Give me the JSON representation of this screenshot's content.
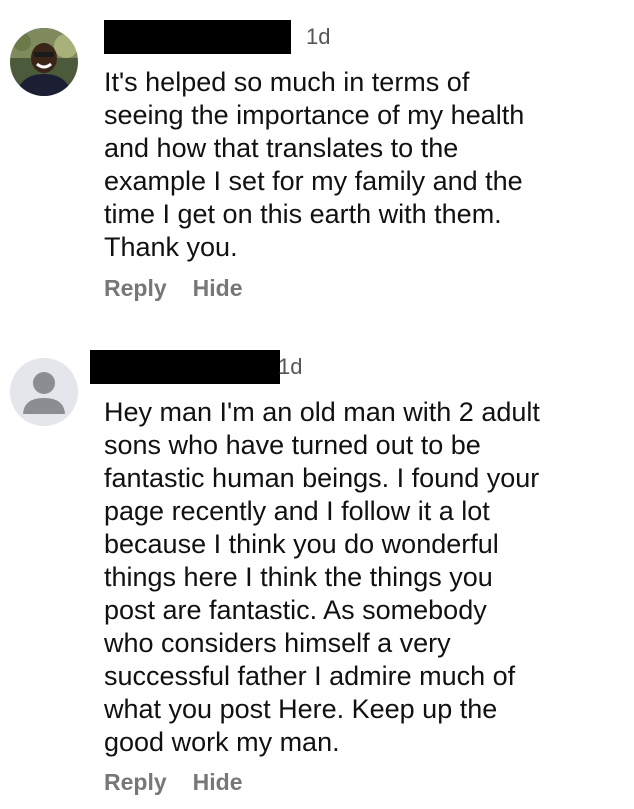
{
  "comments": [
    {
      "time": "1d",
      "text_lines": [
        "It's helped so much in terms of",
        "seeing the importance of my health",
        "and how that translates to the",
        "example I set for my family and the",
        "time I get on this earth with them.",
        "Thank you."
      ],
      "reply_label": "Reply",
      "hide_label": "Hide",
      "avatar": "user-photo"
    },
    {
      "time": "1d",
      "text_lines": [
        "Hey man I'm an old man with 2 adult",
        "sons who have turned out to be",
        "fantastic human beings. I found your",
        "page recently and I follow it a lot",
        "because I think you do wonderful",
        "things here I think the things you",
        "post are fantastic. As somebody",
        "who considers himself a very",
        "successful father I admire much of",
        "what you post Here. Keep up the",
        "good work my man."
      ],
      "reply_label": "Reply",
      "hide_label": "Hide",
      "avatar": "default-avatar"
    }
  ],
  "colors": {
    "text": "#111111",
    "meta": "#777777",
    "redaction": "#000000",
    "default_avatar_bg": "#e4e6eb",
    "default_avatar_fg": "#8a8d91"
  }
}
